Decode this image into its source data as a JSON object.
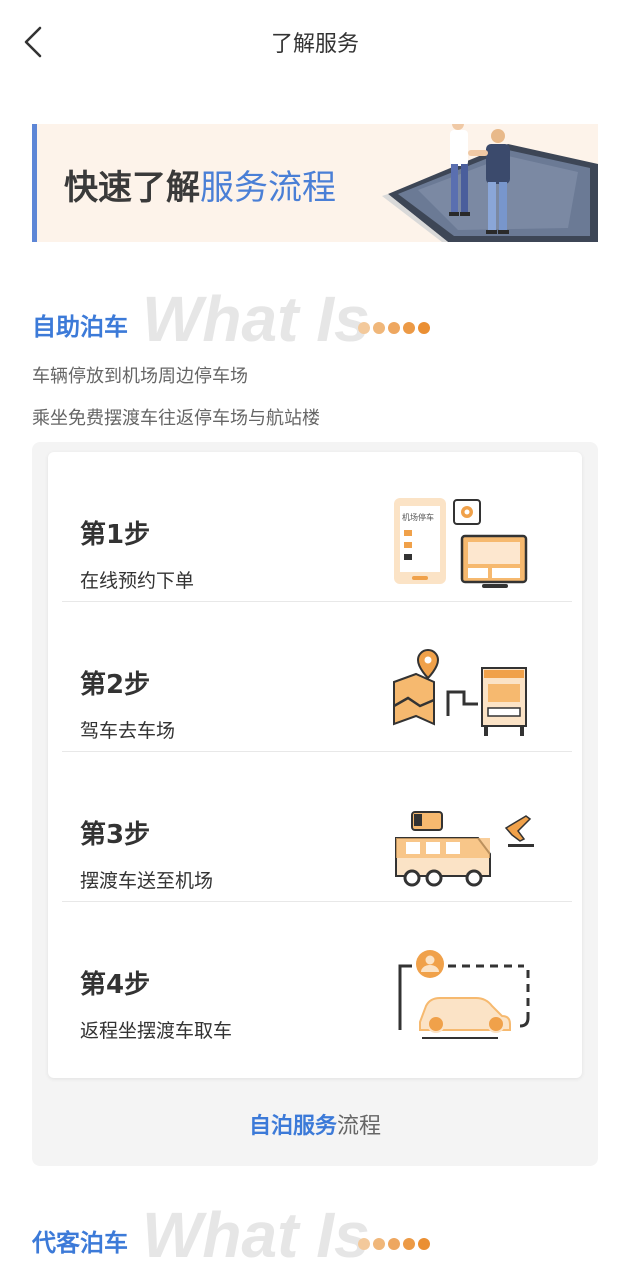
{
  "nav": {
    "title": "了解服务",
    "back_icon": "chevron-left-icon"
  },
  "banner": {
    "text_dark": "快速了解",
    "text_highlight": "服务流程",
    "accent": "#5d86d6"
  },
  "self_parking": {
    "label": "自助泊车",
    "watermark": "What Is",
    "desc_lines": [
      "车辆停放到机场周边停车场",
      "乘坐免费摆渡车往返停车场与航站楼"
    ]
  },
  "steps": [
    {
      "title": "第1步",
      "desc": "在线预约下单",
      "icon": "phone-monitor-icon",
      "icon_text": "机场停车"
    },
    {
      "title": "第2步",
      "desc": "驾车去车场",
      "icon": "map-gate-icon"
    },
    {
      "title": "第3步",
      "desc": "摆渡车送至机场",
      "icon": "shuttle-bus-plane-icon"
    },
    {
      "title": "第4步",
      "desc": "返程坐摆渡车取车",
      "icon": "car-pickup-icon"
    }
  ],
  "flow_link": {
    "strong": "自泊服务",
    "rest": "流程"
  },
  "valet": {
    "label": "代客泊车",
    "watermark": "What Is"
  },
  "colors": {
    "blue": "#3c7ad8",
    "orange": "#f0a14a"
  }
}
